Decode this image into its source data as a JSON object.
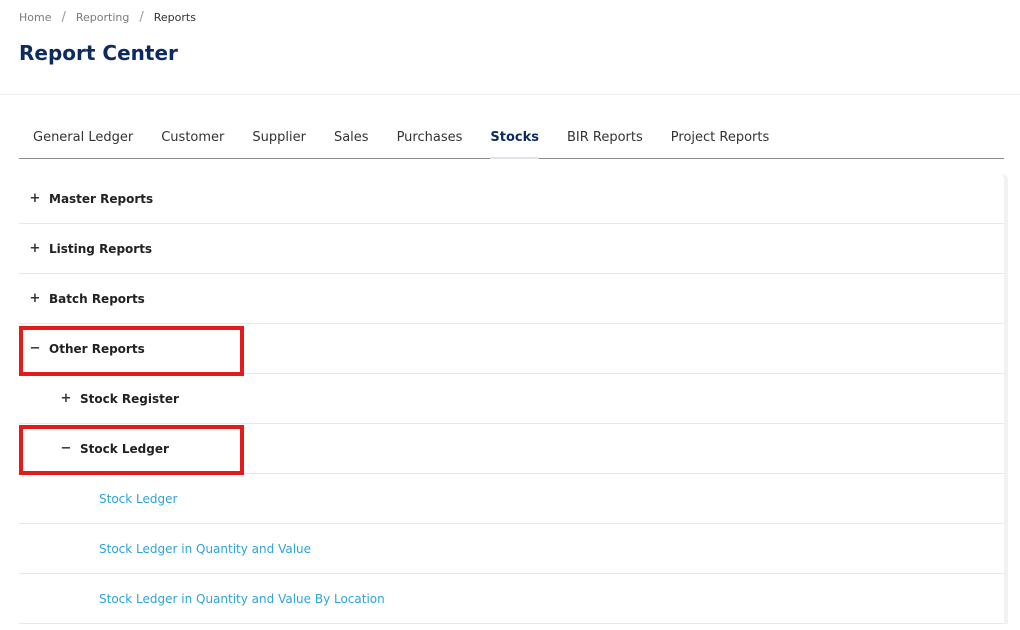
{
  "breadcrumb": {
    "items": [
      "Home",
      "Reporting",
      "Reports"
    ],
    "separator": "/"
  },
  "page": {
    "title": "Report Center"
  },
  "tabs": [
    {
      "label": "General Ledger",
      "active": false
    },
    {
      "label": "Customer",
      "active": false
    },
    {
      "label": "Supplier",
      "active": false
    },
    {
      "label": "Sales",
      "active": false
    },
    {
      "label": "Purchases",
      "active": false
    },
    {
      "label": "Stocks",
      "active": true
    },
    {
      "label": "BIR Reports",
      "active": false
    },
    {
      "label": "Project Reports",
      "active": false
    }
  ],
  "tree": {
    "master": {
      "toggle": "+",
      "label": "Master Reports"
    },
    "listing": {
      "toggle": "+",
      "label": "Listing Reports"
    },
    "batch": {
      "toggle": "+",
      "label": "Batch Reports"
    },
    "other": {
      "toggle": "−",
      "label": "Other Reports"
    },
    "stock_register": {
      "toggle": "+",
      "label": "Stock Register"
    },
    "stock_ledger": {
      "toggle": "−",
      "label": "Stock Ledger"
    },
    "links": [
      "Stock Ledger",
      "Stock Ledger in Quantity and Value",
      "Stock Ledger in Quantity and Value By Location"
    ]
  },
  "colors": {
    "title": "#0d2b5e",
    "link": "#2ea3d8",
    "highlight": "#e21b1b"
  }
}
